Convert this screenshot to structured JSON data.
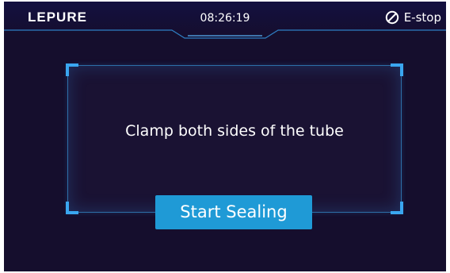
{
  "header": {
    "logo": "LEPURE",
    "time": "08:26:19",
    "estop_label": "E-stop",
    "estop_icon": "no-entry-icon"
  },
  "panel": {
    "instruction": "Clamp both sides of the tube",
    "start_label": "Start  Sealing"
  },
  "colors": {
    "background": "#150e2d",
    "accent_line": "#2f7fc4",
    "corner": "#3aa6f0",
    "button": "#1f9ad6",
    "text": "#ffffff"
  }
}
